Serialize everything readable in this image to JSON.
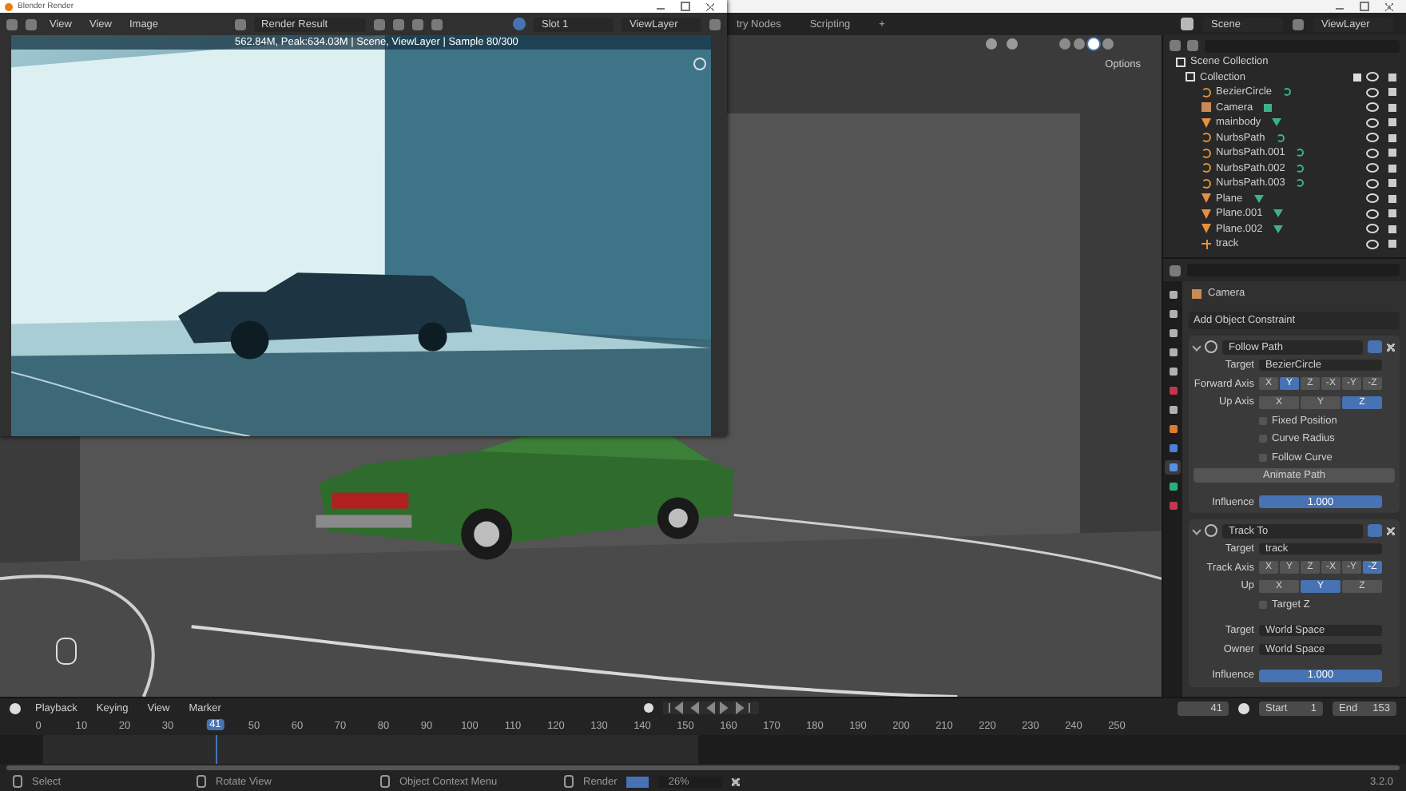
{
  "topbar": {
    "workspaces": [
      {
        "label": "try Nodes",
        "selected": false
      },
      {
        "label": "Scripting",
        "selected": false
      }
    ],
    "add": "+",
    "scene": "Scene",
    "view_layer": "ViewLayer"
  },
  "render_window": {
    "title": "Blender Render",
    "menus": [
      "View",
      "View",
      "Image"
    ],
    "image_name": "Render Result",
    "slot": "Slot 1",
    "view_layer": "ViewLayer",
    "stats": "562.84M, Peak:634.03M | Scene, ViewLayer | Sample 80/300"
  },
  "viewport": {
    "options": "Options"
  },
  "outliner": {
    "root": "Scene Collection",
    "collection": {
      "name": "Collection",
      "checked": true
    },
    "items": [
      {
        "name": "BezierCircle",
        "kind": "curve"
      },
      {
        "name": "Camera",
        "kind": "camera"
      },
      {
        "name": "mainbody",
        "kind": "mesh"
      },
      {
        "name": "NurbsPath",
        "kind": "curve"
      },
      {
        "name": "NurbsPath.001",
        "kind": "curve"
      },
      {
        "name": "NurbsPath.002",
        "kind": "curve"
      },
      {
        "name": "NurbsPath.003",
        "kind": "curve"
      },
      {
        "name": "Plane",
        "kind": "mesh"
      },
      {
        "name": "Plane.001",
        "kind": "mesh"
      },
      {
        "name": "Plane.002",
        "kind": "mesh"
      },
      {
        "name": "track",
        "kind": "empty"
      }
    ]
  },
  "properties": {
    "tabs": [
      {
        "color": "#b0b0b0",
        "selected": false
      },
      {
        "color": "#b0b0b0",
        "selected": false
      },
      {
        "color": "#b0b0b0",
        "selected": false
      },
      {
        "color": "#b0b0b0",
        "selected": false
      },
      {
        "color": "#b0b0b0",
        "selected": false
      },
      {
        "color": "#c0394a",
        "selected": false
      },
      {
        "color": "#b0b0b0",
        "selected": false
      },
      {
        "color": "#e07a2c",
        "selected": false
      },
      {
        "color": "#4d7fd6",
        "selected": false
      },
      {
        "color": "#5a8fe0",
        "selected": true
      },
      {
        "color": "#2fae7a",
        "selected": false
      },
      {
        "color": "#c0394a",
        "selected": false
      }
    ],
    "object": "Camera",
    "add_constraint": "Add Object Constraint",
    "constraints": [
      {
        "name": "Follow Path",
        "expanded": true,
        "rows": [
          {
            "kind": "target",
            "label": "Target",
            "value": "BezierCircle"
          },
          {
            "kind": "axis",
            "label": "Forward Axis",
            "options": [
              {
                "label": "X",
                "selected": false
              },
              {
                "label": "Y",
                "selected": true
              },
              {
                "label": "Z",
                "selected": false
              },
              {
                "label": "-X",
                "selected": false
              },
              {
                "label": "-Y",
                "selected": false
              },
              {
                "label": "-Z",
                "selected": false
              }
            ]
          },
          {
            "kind": "axis",
            "label": "Up Axis",
            "options": [
              {
                "label": "X",
                "selected": false
              },
              {
                "label": "Y",
                "selected": false
              },
              {
                "label": "Z",
                "selected": true
              }
            ]
          },
          {
            "kind": "checkbox",
            "label": "Fixed Position",
            "checked": false
          },
          {
            "kind": "checkbox",
            "label": "Curve Radius",
            "checked": false
          },
          {
            "kind": "checkbox",
            "label": "Follow Curve",
            "checked": false
          },
          {
            "kind": "button",
            "label": "Animate Path"
          },
          {
            "kind": "slider",
            "label": "Influence",
            "value": "1.000",
            "level": 1
          }
        ]
      },
      {
        "name": "Track To",
        "expanded": true,
        "rows": [
          {
            "kind": "target",
            "label": "Target",
            "value": "track"
          },
          {
            "kind": "axis",
            "label": "Track Axis",
            "options": [
              {
                "label": "X",
                "selected": false
              },
              {
                "label": "Y",
                "selected": false
              },
              {
                "label": "Z",
                "selected": false
              },
              {
                "label": "-X",
                "selected": false
              },
              {
                "label": "-Y",
                "selected": false
              },
              {
                "label": "-Z",
                "selected": true
              }
            ]
          },
          {
            "kind": "axis",
            "label": "Up",
            "options": [
              {
                "label": "X",
                "selected": false
              },
              {
                "label": "Y",
                "selected": true
              },
              {
                "label": "Z",
                "selected": false
              }
            ]
          },
          {
            "kind": "checkbox",
            "label": "Target Z",
            "checked": false
          },
          {
            "kind": "dropdown",
            "label": "Target",
            "value": "World Space"
          },
          {
            "kind": "dropdown",
            "label": "Owner",
            "value": "World Space"
          },
          {
            "kind": "slider",
            "label": "Influence",
            "value": "1.000",
            "level": 1
          }
        ]
      }
    ]
  },
  "timeline": {
    "menus": [
      "Playback",
      "Keying",
      "View",
      "Marker"
    ],
    "frame": "41",
    "playhead": "41",
    "start_label": "Start",
    "start": "1",
    "end_label": "End",
    "end": "153",
    "ticks": [
      "0",
      "10",
      "20",
      "30",
      "50",
      "60",
      "70",
      "80",
      "90",
      "100",
      "110",
      "120",
      "130",
      "140",
      "150",
      "160",
      "170",
      "180",
      "190",
      "200",
      "210",
      "220",
      "230",
      "240",
      "250"
    ]
  },
  "status_bar": {
    "hints": [
      "Select",
      "Rotate View",
      "Object Context Menu"
    ],
    "render_label": "Render",
    "render_progress": {
      "level": 1
    },
    "render_percent": "26%",
    "version": "3.2.0"
  }
}
